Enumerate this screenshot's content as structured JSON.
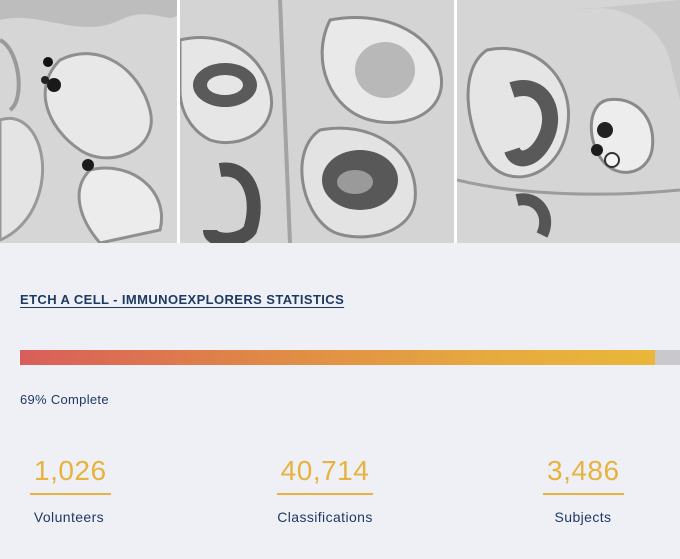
{
  "hero": {
    "images": [
      {
        "name": "tissue-image-1"
      },
      {
        "name": "tissue-image-2"
      },
      {
        "name": "tissue-image-3"
      }
    ]
  },
  "project": {
    "title": "ETCH A CELL - IMMUNOEXPLORERS STATISTICS"
  },
  "progress": {
    "percent": 69,
    "label": "69% Complete",
    "colors": {
      "start": "#d95e5a",
      "end": "#e9b739",
      "track": "#c9c9cc"
    }
  },
  "stats": [
    {
      "value": "1,026",
      "label": "Volunteers"
    },
    {
      "value": "40,714",
      "label": "Classifications"
    },
    {
      "value": "3,486",
      "label": "Subjects"
    }
  ],
  "colors": {
    "accent": "#e7b23d",
    "text": "#1d3a63",
    "background": "#eff0f5"
  }
}
